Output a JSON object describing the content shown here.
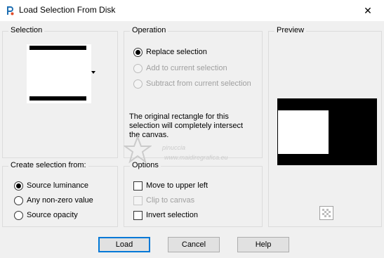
{
  "window": {
    "title": "Load Selection From Disk",
    "close_glyph": "✕"
  },
  "selection_group": {
    "title": "Selection"
  },
  "operation_group": {
    "title": "Operation",
    "options": [
      {
        "label": "Replace selection",
        "checked": true,
        "enabled": true
      },
      {
        "label": "Add to current selection",
        "checked": false,
        "enabled": false
      },
      {
        "label": "Subtract from current selection",
        "checked": false,
        "enabled": false
      }
    ],
    "info_text": "The original rectangle for this selection will completely intersect the canvas."
  },
  "preview_group": {
    "title": "Preview"
  },
  "create_from_group": {
    "title": "Create selection from:",
    "options": [
      {
        "label": "Source luminance",
        "checked": true
      },
      {
        "label": "Any non-zero value",
        "checked": false
      },
      {
        "label": "Source opacity",
        "checked": false
      }
    ]
  },
  "options_group": {
    "title": "Options",
    "items": [
      {
        "label": "Move to upper left",
        "checked": false,
        "enabled": true
      },
      {
        "label": "Clip to canvas",
        "checked": false,
        "enabled": false
      },
      {
        "label": "Invert selection",
        "checked": false,
        "enabled": true
      }
    ]
  },
  "buttons": {
    "load": "Load",
    "cancel": "Cancel",
    "help": "Help"
  },
  "watermark": {
    "line1": "pinuccia",
    "line2": "www.maidiregrafica.eu"
  },
  "icons": {
    "app": "paint-shop-pro-icon",
    "dropdown": "dropdown-arrow-icon",
    "transparency": "checkerboard-icon"
  }
}
